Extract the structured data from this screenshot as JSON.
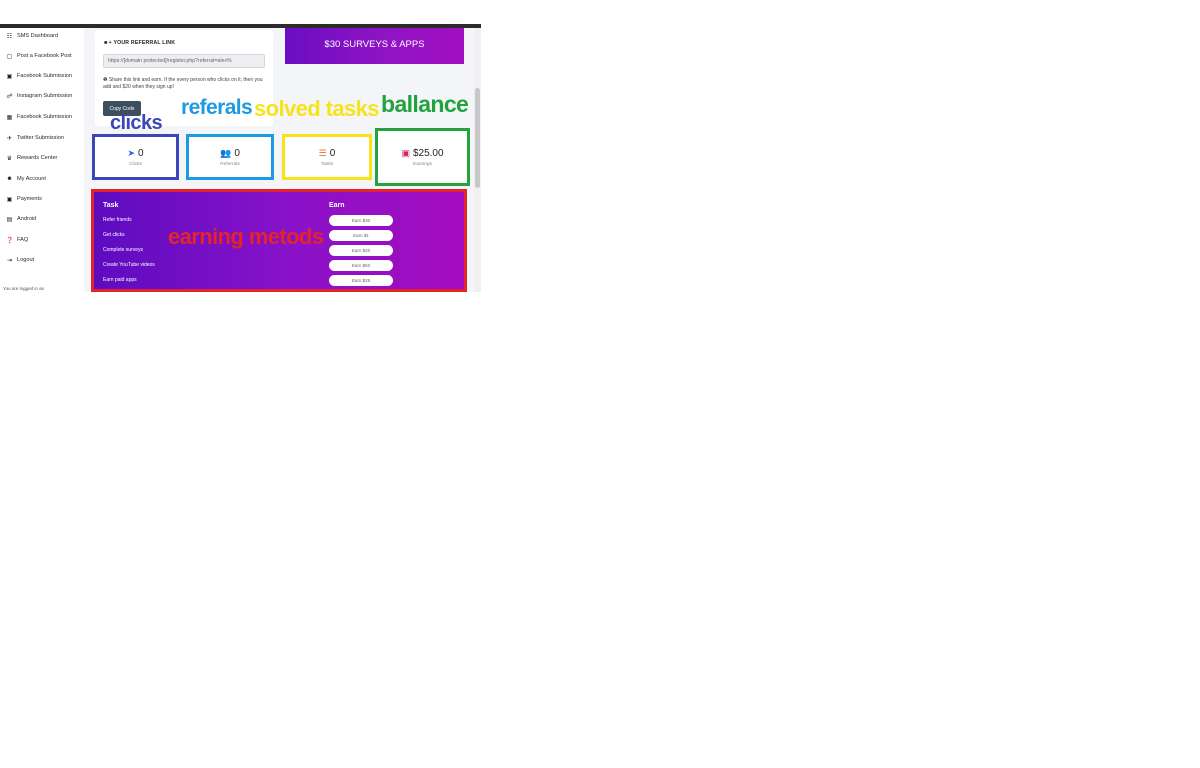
{
  "sidebar": {
    "items": [
      {
        "icon": "dashboard-icon",
        "glyph": "☷",
        "label": "SMS Dashboard"
      },
      {
        "icon": "document-icon",
        "glyph": "▢",
        "label": "Post a Facebook Post"
      },
      {
        "icon": "video-icon",
        "glyph": "▣",
        "label": "Facebook Submission"
      },
      {
        "icon": "instagram-icon",
        "glyph": "☍",
        "label": "Instagram Submission"
      },
      {
        "icon": "facebook-icon",
        "glyph": "▦",
        "label": "Facebook Submission"
      },
      {
        "icon": "twitter-icon",
        "glyph": "✈",
        "label": "Twitter Submission"
      },
      {
        "icon": "trophy-icon",
        "glyph": "♛",
        "label": "Rewards Center"
      },
      {
        "icon": "user-icon",
        "glyph": "☻",
        "label": "My Account"
      },
      {
        "icon": "payments-icon",
        "glyph": "▣",
        "label": "Payments"
      },
      {
        "icon": "android-icon",
        "glyph": "▤",
        "label": "Android"
      },
      {
        "icon": "help-icon",
        "glyph": "❓",
        "label": "FAQ"
      },
      {
        "icon": "logout-icon",
        "glyph": "⇥",
        "label": "Logout"
      }
    ],
    "footer": "You are logged in as"
  },
  "referral": {
    "title": "YOUR REFERRAL LINK",
    "link": "https://[domain protected]/register.php?referral=alex%",
    "note": "Share this link and earn. If the every person who clicks on it, then you add and $20 when they sign up!",
    "copy_label": "Copy Code"
  },
  "banner": {
    "text": "$30 SURVEYS & APPS"
  },
  "stats": {
    "clicks": {
      "value": "0",
      "label": "Clicks"
    },
    "referrals": {
      "value": "0",
      "label": "Referrals"
    },
    "tasks": {
      "value": "0",
      "label": "Tasks"
    },
    "earnings": {
      "value": "$25.00",
      "label": "Earnings"
    }
  },
  "earn": {
    "task_header": "Task",
    "earn_header": "Earn",
    "rows": [
      {
        "task": "Refer friends",
        "earn": "Earn $30"
      },
      {
        "task": "Get clicks",
        "earn": "Earn $1"
      },
      {
        "task": "Complete surveys",
        "earn": "Earn $20"
      },
      {
        "task": "Create YouTube videos",
        "earn": "Earn $50"
      },
      {
        "task": "Earn paid apps",
        "earn": "Earn $25"
      }
    ]
  },
  "annotations": {
    "clicks": "clicks",
    "referals": "referals",
    "solved_tasks": "solved tasks",
    "ballance": "ballance",
    "earning_metods": "earning metods"
  },
  "colors": {
    "annot_clicks": "#3b46b8",
    "annot_referals": "#1e9be0",
    "annot_tasks": "#f7e31b",
    "annot_ballance": "#23a33e",
    "annot_earn": "#e3242b",
    "purple": "#7a10c4",
    "copy_button": "#3d4f5f"
  }
}
